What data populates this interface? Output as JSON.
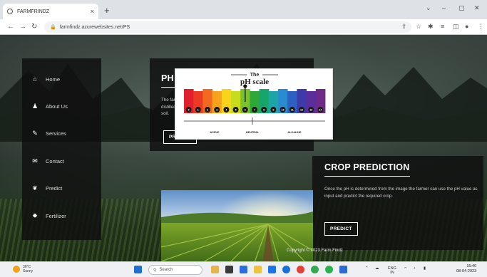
{
  "browser": {
    "tab_title": "FARMFRINDZ",
    "tab_close": "×",
    "new_tab": "+",
    "url": "farmfindz.azurewebsites.net/PS",
    "window_controls": {
      "minimize": "⌄",
      "restore": "–",
      "maximize": "▢",
      "close": "✕"
    }
  },
  "sidebar": {
    "items": [
      {
        "label": "Home",
        "icon": "home-icon"
      },
      {
        "label": "About Us",
        "icon": "user-icon"
      },
      {
        "label": "Services",
        "icon": "pencil-icon"
      },
      {
        "label": "Contact",
        "icon": "envelope-icon"
      },
      {
        "label": "Predict",
        "icon": "leaf-icon"
      },
      {
        "label": "Fertilizer",
        "icon": "cog-icon"
      }
    ]
  },
  "ph_section": {
    "title": "PH PREDICTION",
    "description": "The farmer needs to perform a manual soil test with litmus paper and distilled water. Upload the image of litmus paper to determine the pH of the soil.",
    "button_label": "PREDICT"
  },
  "ph_scale": {
    "top_word": "The",
    "title": "pH scale",
    "numbers": [
      "0",
      "1",
      "2",
      "3",
      "4",
      "5",
      "6",
      "7",
      "8",
      "9",
      "10",
      "11",
      "12",
      "13",
      "14"
    ],
    "labels": [
      "ACIDIC",
      "NEUTRAL",
      "ALKALINE"
    ],
    "colors": [
      "#e0202a",
      "#ec3a24",
      "#f26a1f",
      "#f7a21b",
      "#f8d51a",
      "#c9dc1c",
      "#7cc22a",
      "#2fa83a",
      "#17a56c",
      "#1ca6a8",
      "#2b8bd0",
      "#2e5fc2",
      "#3e3ba8",
      "#5a2e9c",
      "#6d2a86"
    ]
  },
  "crop_section": {
    "title": "CROP PREDICTION",
    "description": "Once the pH is determined from the image the farmer can use the pH value as input and predict the required crop.",
    "button_label": "PREDICT"
  },
  "footer": {
    "copyright": "Copyright © 2023 Farm Findz"
  },
  "taskbar": {
    "weather_temp": "30°C",
    "weather_desc": "Sunny",
    "search_placeholder": "Search",
    "lang_top": "ENG",
    "lang_bottom": "IN",
    "time": "15:40",
    "date": "08-04-2023"
  }
}
